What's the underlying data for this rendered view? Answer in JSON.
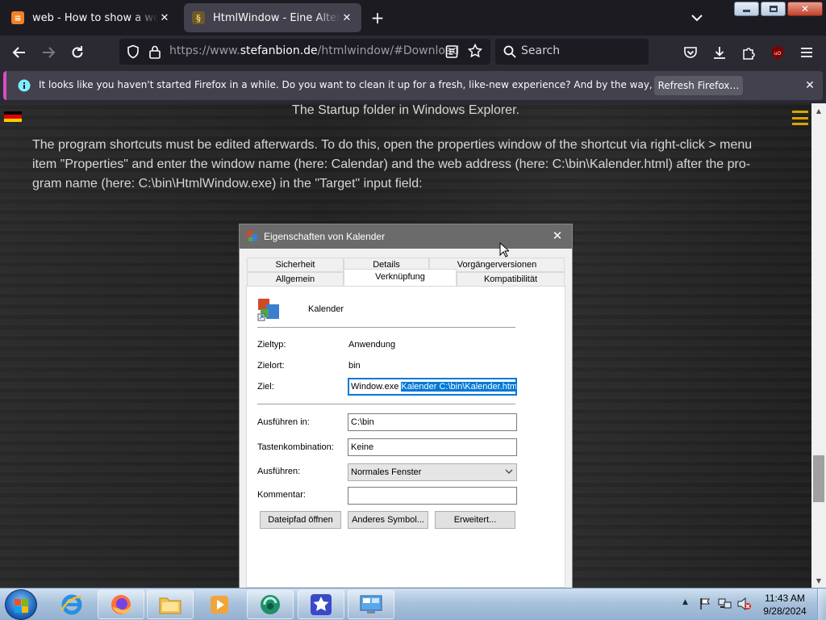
{
  "browser": {
    "tabs": [
      {
        "title": "web - How to show a website a",
        "active": false
      },
      {
        "title": "HtmlWindow - Eine Alternative",
        "active": true
      }
    ],
    "url": {
      "scheme": "https://www.",
      "host": "stefanbion.de",
      "path": "/htmlwindow/#Download"
    },
    "search_placeholder": "Search",
    "notification": {
      "text": "It looks like you haven't started Firefox in a while. Do you want to clean it up for a fresh, like-new experience? And by the way, welcome back!",
      "button": "Refresh Firefox…"
    }
  },
  "page": {
    "caption": "The Startup folder in Windows Explorer.",
    "paragraph_lines": [
      "The program shortcuts must be edited afterwards. To do this, open the properties window of the shortcut via right-click > menu",
      "item \"Properties\" and enter the window name (here: Calendar) and the web address (here: C:\\bin\\Kalender.html) after the pro-",
      "gram name (here: C:\\bin\\HtmlWindow.exe) in the \"Target\" input field:"
    ]
  },
  "dialog": {
    "title": "Eigenschaften von Kalender",
    "tabs_row1": [
      "Sicherheit",
      "Details",
      "Vorgängerversionen"
    ],
    "tabs_row2": [
      "Allgemein",
      "Verknüpfung",
      "Kompatibilität"
    ],
    "selected_tab": "Verknüpfung",
    "shortcut_name": "Kalender",
    "zieltyp_label": "Zieltyp:",
    "zieltyp_value": "Anwendung",
    "zielort_label": "Zielort:",
    "zielort_value": "bin",
    "ziel_label": "Ziel:",
    "ziel_value_plain": "Window.exe ",
    "ziel_value_selected": "Kalender C:\\bin\\Kalender.html",
    "ausfuehren_in_label": "Ausführen in:",
    "ausfuehren_in_value": "C:\\bin",
    "tasten_label": "Tastenkombination:",
    "tasten_value": "Keine",
    "ausfuehren_label": "Ausführen:",
    "ausfuehren_value": "Normales Fenster",
    "kommentar_label": "Kommentar:",
    "kommentar_value": "",
    "buttons": [
      "Dateipfad öffnen",
      "Anderes Symbol...",
      "Erweitert..."
    ]
  },
  "taskbar": {
    "apps": [
      "internet-explorer",
      "firefox",
      "file-explorer",
      "media-player",
      "browser-app",
      "star-app",
      "control-panel"
    ],
    "time": "11:43 AM",
    "date": "9/28/2024"
  },
  "colors": {
    "firefox_dark": "#1c1b22",
    "toolbar": "#2b2a33",
    "notification_accent": "#d74ec1",
    "selection_blue": "#0078d7",
    "menu_accent": "#d9a400"
  }
}
